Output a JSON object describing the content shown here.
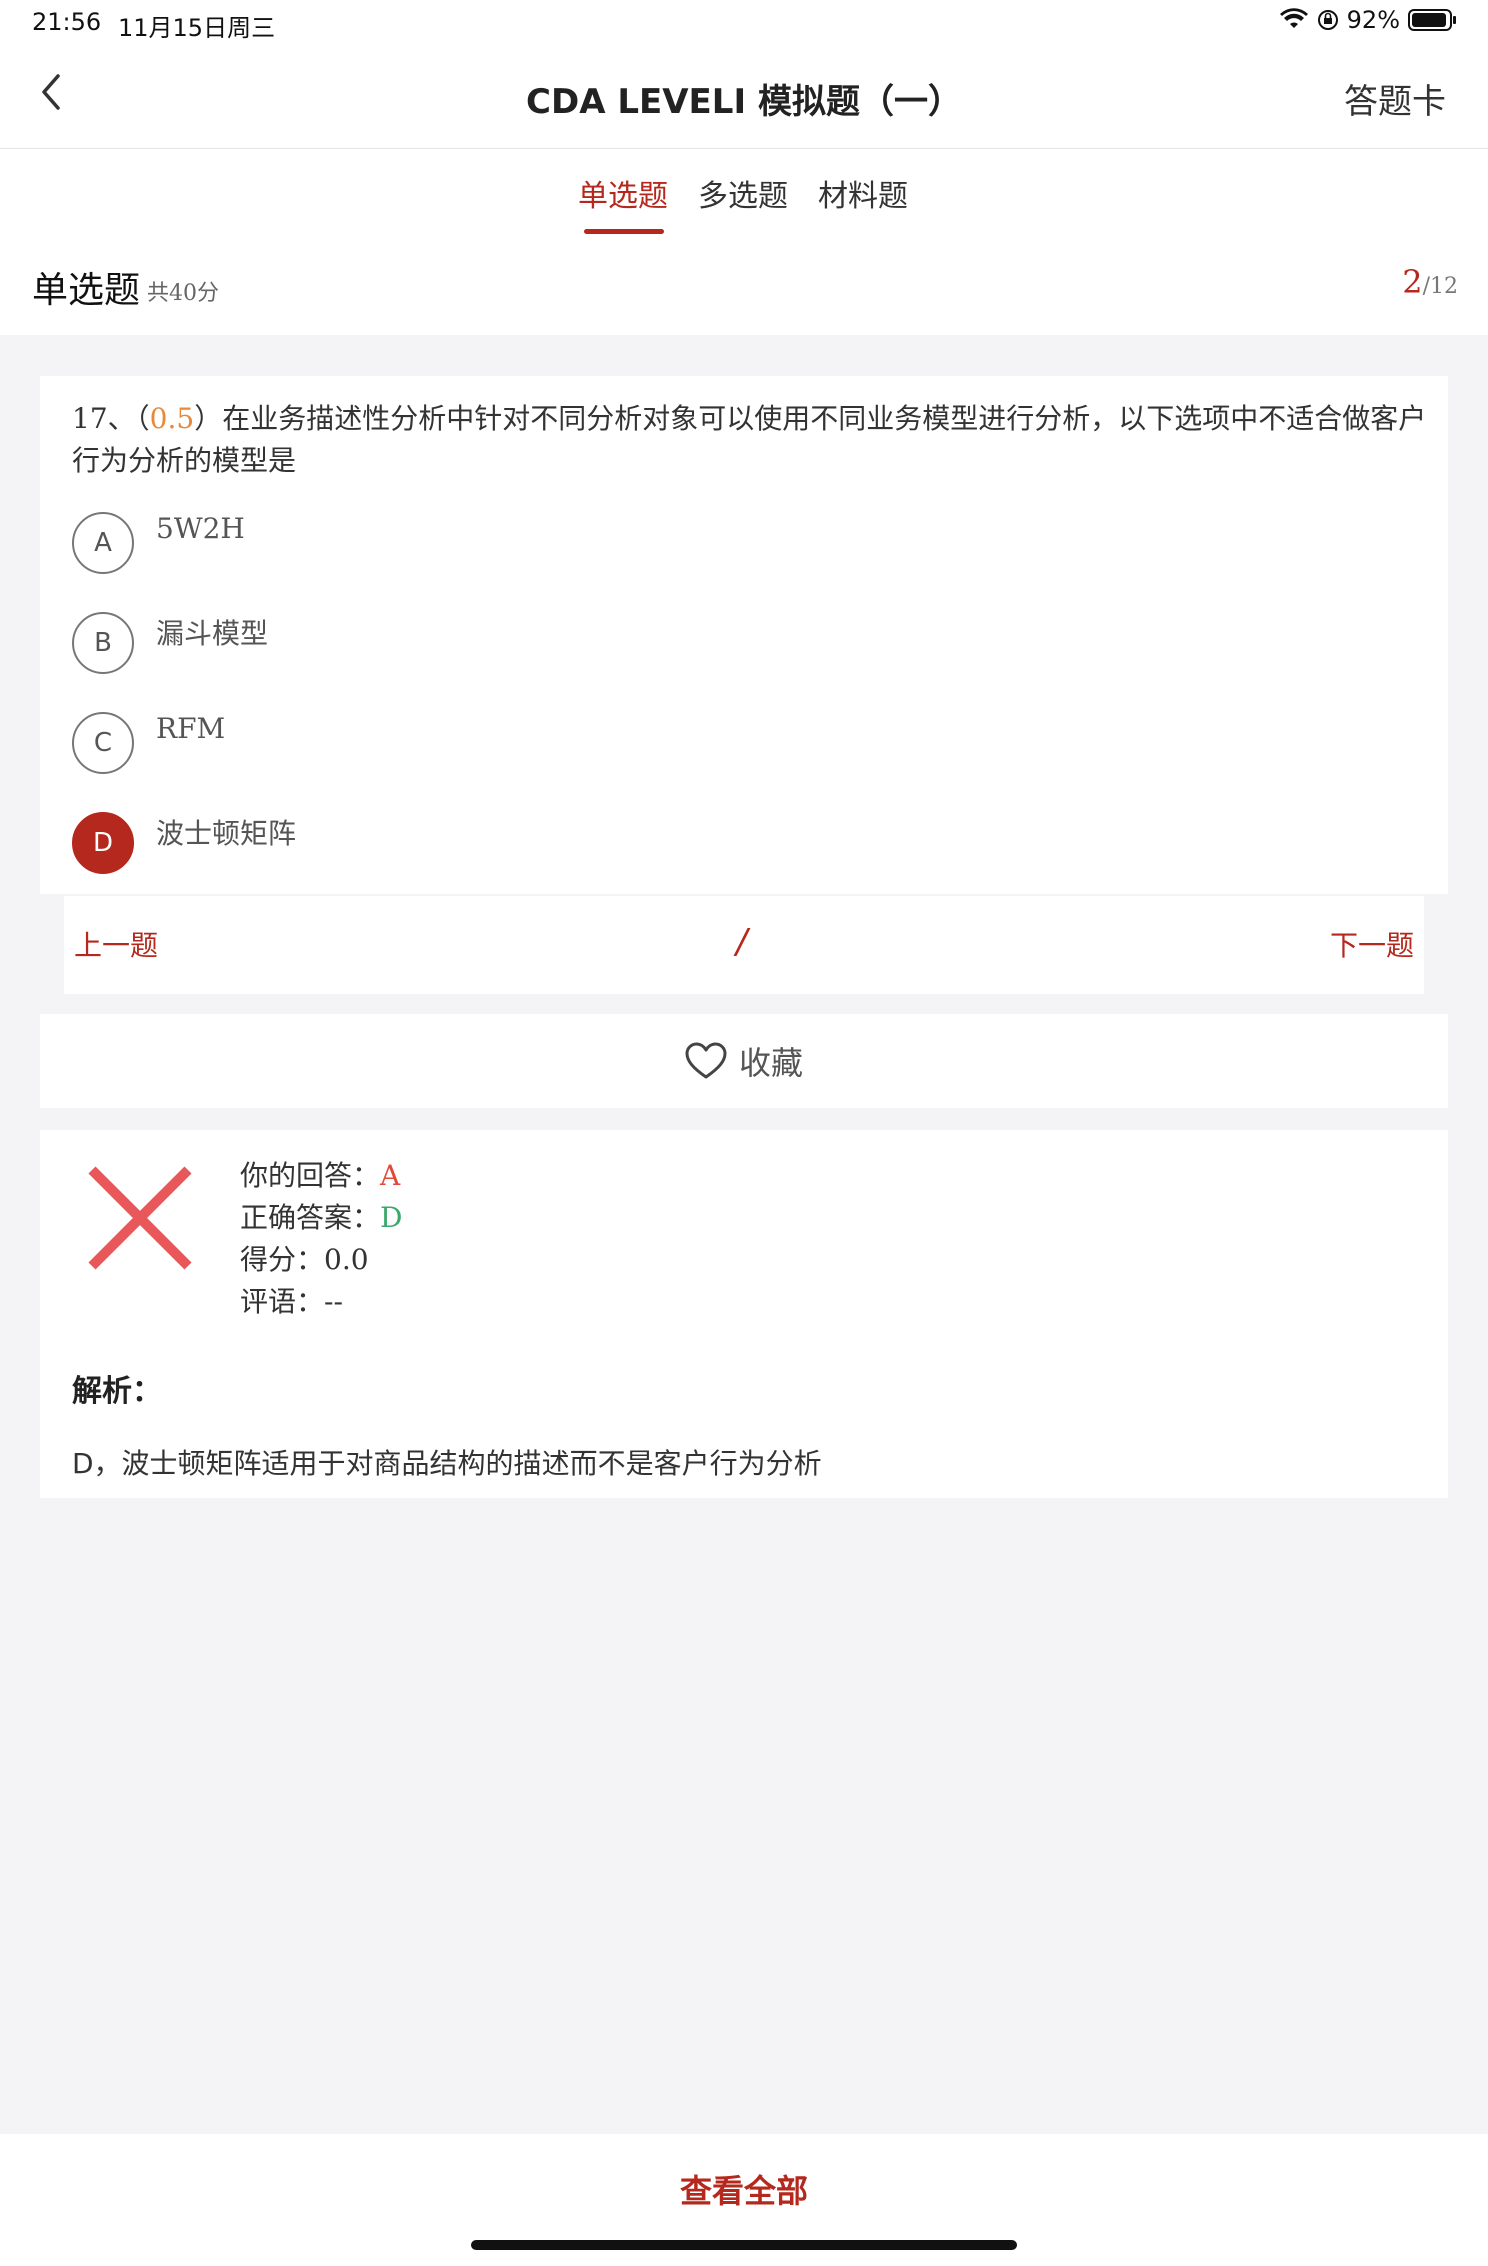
{
  "status": {
    "time": "21:56",
    "date": "11月15日周三",
    "battery": "92%"
  },
  "nav": {
    "title": "CDA LEVELI 模拟题（一）",
    "answer_card": "答题卡"
  },
  "tabs": [
    {
      "label": "单选题",
      "active": true
    },
    {
      "label": "多选题",
      "active": false
    },
    {
      "label": "材料题",
      "active": false
    }
  ],
  "section": {
    "title": "单选题",
    "score": "共40分",
    "current": "2",
    "total": "/12"
  },
  "question": {
    "number": "17、",
    "score_open": "（",
    "score": "0.5",
    "score_close": "）",
    "text": "在业务描述性分析中针对不同分析对象可以使用不同业务模型进行分析，以下选项中不适合做客户行为分析的模型是",
    "options": [
      {
        "letter": "A",
        "text": "5W2H",
        "selected": false
      },
      {
        "letter": "B",
        "text": "漏斗模型",
        "selected": false
      },
      {
        "letter": "C",
        "text": "RFM",
        "selected": false
      },
      {
        "letter": "D",
        "text": "波士顿矩阵",
        "selected": true
      }
    ]
  },
  "pager": {
    "prev": "上一题",
    "separator": "/",
    "next": "下一题"
  },
  "collect": {
    "label": "收藏",
    "icon": "heart-icon"
  },
  "result": {
    "your_answer_label": "你的回答：",
    "your_answer": "A",
    "correct_label": "正确答案：",
    "correct": "D",
    "score_label": "得分：",
    "score": "0.0",
    "comment_label": "评语：",
    "comment": "--",
    "analysis_title": "解析：",
    "analysis_text": "D，波士顿矩阵适用于对商品结构的描述而不是客户行为分析"
  },
  "bottom": {
    "view_all": "查看全部"
  },
  "colors": {
    "accent": "#b5281d",
    "wrong": "#e04a3a",
    "correct": "#3aa86b",
    "score": "#e8893a"
  }
}
